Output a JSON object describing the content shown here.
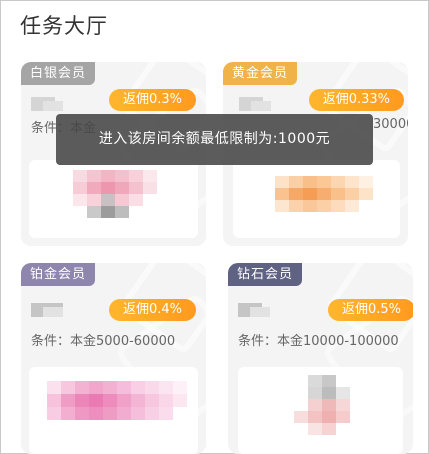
{
  "header": {
    "title": "任务大厅"
  },
  "toast": {
    "message": "进入该房间余额最低限制为:1000元"
  },
  "cards": [
    {
      "badge": "白银会员",
      "badge_color": "#a5a5a5",
      "rebate": "返佣0.3%",
      "condition": "条件：本金"
    },
    {
      "badge": "黄金会员",
      "badge_color": "#efb34a",
      "rebate": "返佣0.33%",
      "condition": "30000"
    },
    {
      "badge": "铂金会员",
      "badge_color": "#8e86ad",
      "rebate": "返佣0.4%",
      "condition": "条件：本金5000-60000"
    },
    {
      "badge": "钻石会员",
      "badge_color": "#5f6283",
      "rebate": "返佣0.5%",
      "condition": "条件：本金10000-100000"
    }
  ]
}
